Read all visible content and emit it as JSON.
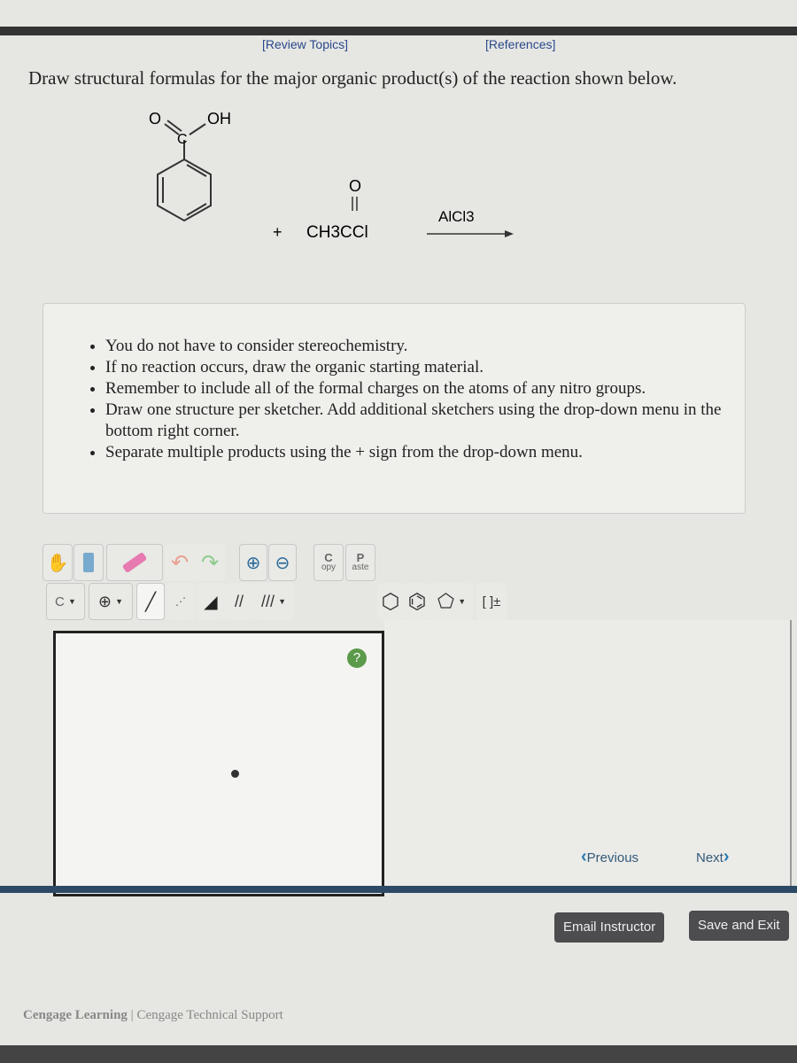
{
  "header": {
    "review_topics": "[Review Topics]",
    "references": "[References]"
  },
  "question": "Draw structural formulas for the major organic product(s) of the reaction shown below.",
  "reaction": {
    "reactant1_carboxyl_O": "O",
    "reactant1_carboxyl_C": "C",
    "reactant1_carboxyl_OH": "OH",
    "plus": "+",
    "reactant2": "CH3CCl",
    "reactant2_carbonyl_O": "O",
    "reagent": "AlCl3"
  },
  "notes": [
    "You do not have to consider stereochemistry.",
    "If no reaction occurs, draw the organic starting material.",
    "Remember to include all of the formal charges on the atoms of any nitro groups.",
    "Draw one structure per sketcher. Add additional sketchers using the drop-down menu in the bottom right corner.",
    "Separate multiple products using the + sign from the drop-down menu."
  ],
  "toolbar": {
    "copy_top": "C",
    "copy_bottom": "opy",
    "paste_top": "P",
    "paste_bottom": "aste",
    "element": "C",
    "charge_label": "[ ]±",
    "help": "?"
  },
  "nav": {
    "previous": "Previous",
    "next": "Next"
  },
  "buttons": {
    "email": "Email Instructor",
    "save": "Save and Exit"
  },
  "footer": {
    "cengage": "Cengage Learning",
    "separator": "|",
    "support": "Cengage Technical Support"
  }
}
